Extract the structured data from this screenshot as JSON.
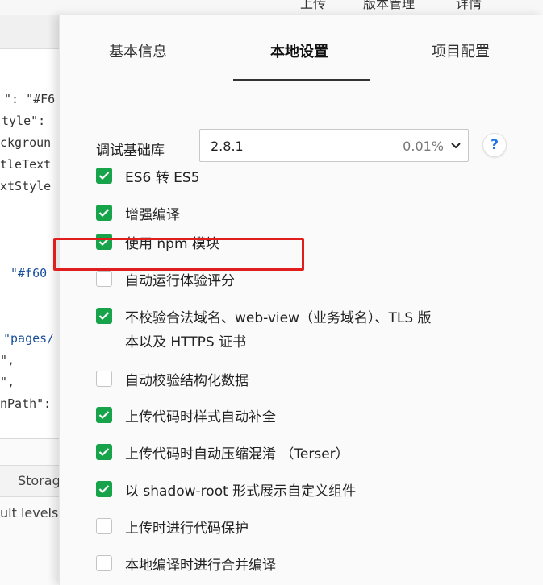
{
  "topbar": {
    "items": [
      "上传",
      "版本管理",
      "详情"
    ]
  },
  "editor": {
    "code_lines": [
      {
        "text": "\": \"#F6"
      },
      {
        "text": "tyle\":"
      },
      {
        "text": "ckgroun"
      },
      {
        "text": "tleText"
      },
      {
        "text": "xtStyle"
      },
      {
        "text": "\"#f60"
      },
      {
        "text": "\"pages/"
      },
      {
        "text": "\","
      },
      {
        "text": "\","
      },
      {
        "text": "nPath\":"
      }
    ],
    "storage_tab": "Storag",
    "levels_text": "ult levels"
  },
  "panel": {
    "tabs": [
      {
        "label": "基本信息",
        "active": false
      },
      {
        "label": "本地设置",
        "active": true
      },
      {
        "label": "项目配置",
        "active": false
      }
    ],
    "debug_lib": {
      "label": "调试基础库",
      "version": "2.8.1",
      "percent": "0.01%",
      "help": "?"
    },
    "options": [
      {
        "label": "ES6 转 ES5",
        "checked": true
      },
      {
        "label": "增强编译",
        "checked": true
      },
      {
        "label": "使用 npm 模块",
        "checked": true
      },
      {
        "label": "自动运行体验评分",
        "checked": false
      },
      {
        "label": "不校验合法域名、web-view（业务域名）、TLS 版",
        "label2": "本以及 HTTPS 证书",
        "checked": true
      },
      {
        "label": "自动校验结构化数据",
        "checked": false
      },
      {
        "label": "上传代码时样式自动补全",
        "checked": true
      },
      {
        "label": "上传代码时自动压缩混淆 （Terser）",
        "checked": true
      },
      {
        "label": "以 shadow-root 形式展示自定义组件",
        "checked": true
      },
      {
        "label": "上传时进行代码保护",
        "checked": false
      },
      {
        "label": "本地编译时进行合并编译",
        "checked": false
      }
    ]
  },
  "colors": {
    "checkbox_on": "#16a34a",
    "highlight": "#e01e1e",
    "help_icon": "#1a73e8"
  }
}
